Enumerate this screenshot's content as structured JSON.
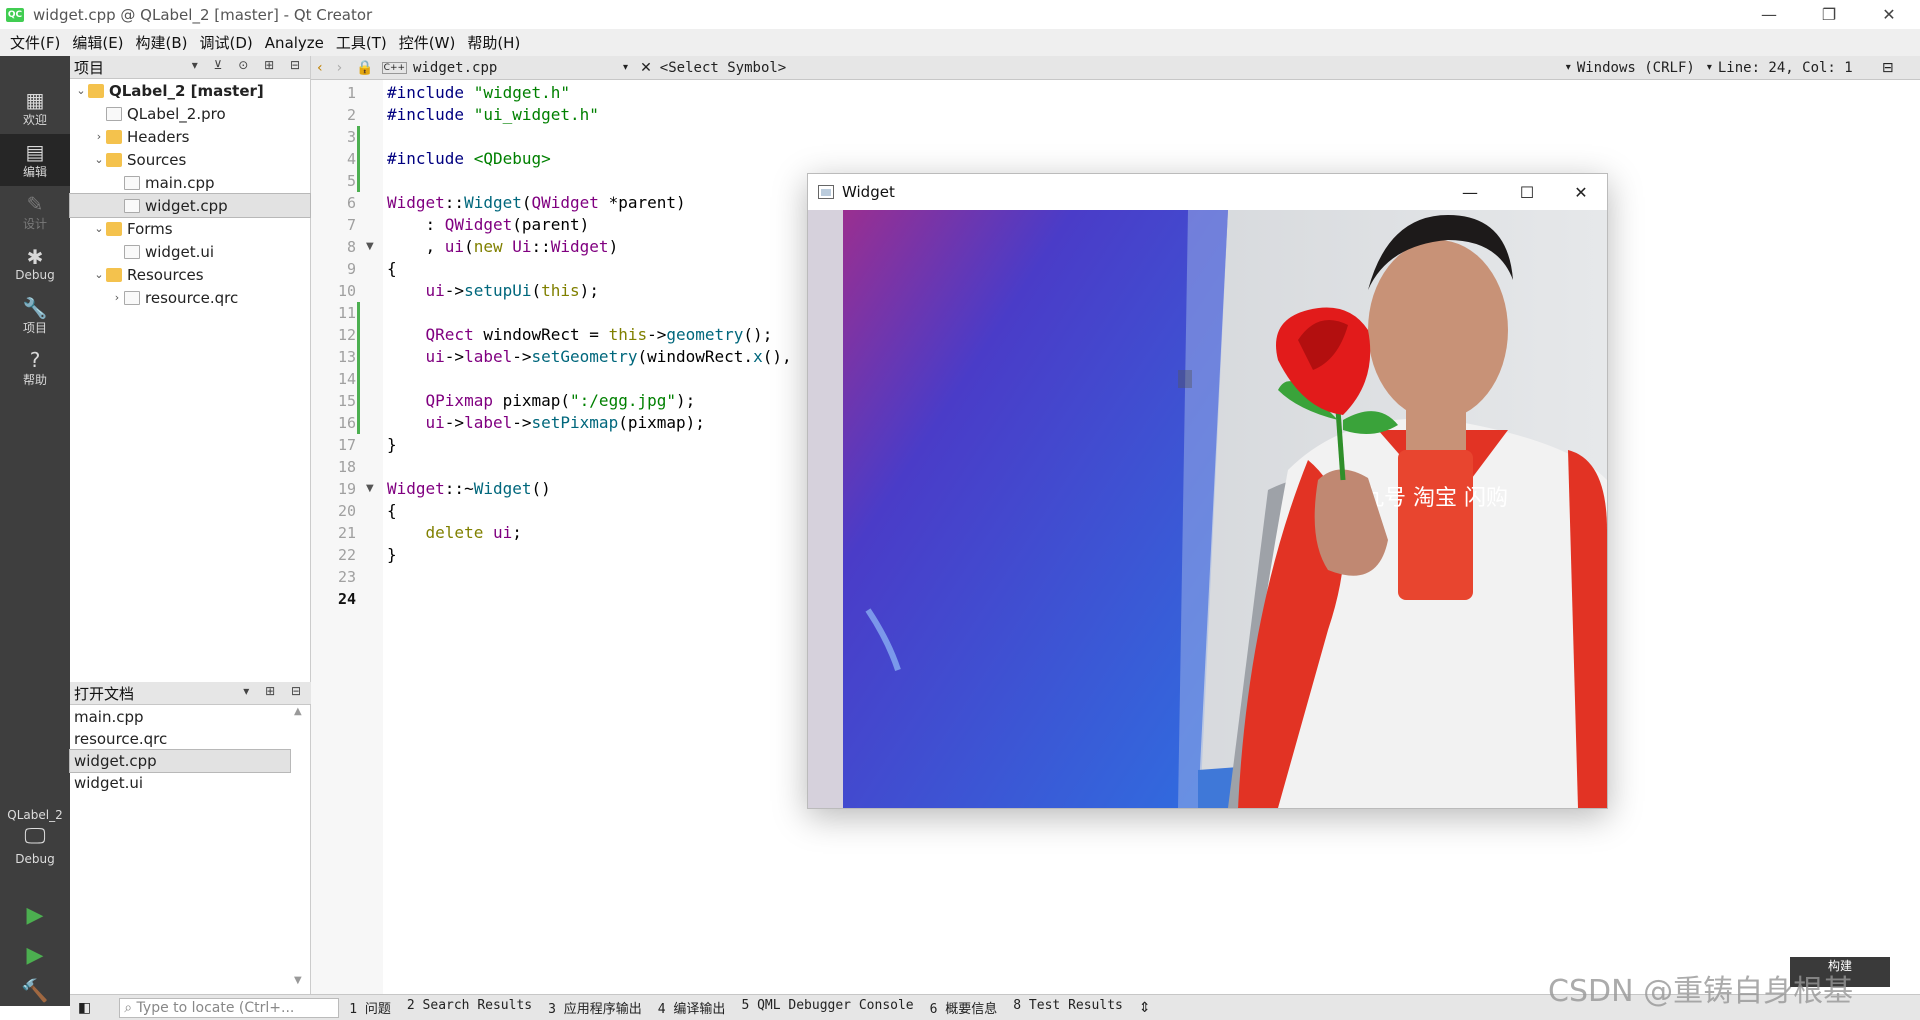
{
  "window": {
    "title": "widget.cpp @ QLabel_2 [master] - Qt Creator",
    "minimize": "—",
    "restore": "❐",
    "close": "✕",
    "icon": "QC"
  },
  "menu": [
    "文件(F)",
    "编辑(E)",
    "构建(B)",
    "调试(D)",
    "Analyze",
    "工具(T)",
    "控件(W)",
    "帮助(H)"
  ],
  "modes": [
    {
      "label": "欢迎",
      "icon": "▦"
    },
    {
      "label": "编辑",
      "icon": "▤"
    },
    {
      "label": "设计",
      "icon": "✎"
    },
    {
      "label": "Debug",
      "icon": "✱"
    },
    {
      "label": "项目",
      "icon": "🔧"
    },
    {
      "label": "帮助",
      "icon": "?"
    }
  ],
  "kit": {
    "project": "QLabel_2",
    "config": "Debug"
  },
  "project_pane": {
    "header": "项目"
  },
  "tree": [
    {
      "label": "QLabel_2 [master]",
      "depth": 0,
      "arrow": "⌄",
      "kind": "folder",
      "bold": true
    },
    {
      "label": "QLabel_2.pro",
      "depth": 1,
      "arrow": "",
      "kind": "file"
    },
    {
      "label": "Headers",
      "depth": 1,
      "arrow": "›",
      "kind": "folder"
    },
    {
      "label": "Sources",
      "depth": 1,
      "arrow": "⌄",
      "kind": "folder"
    },
    {
      "label": "main.cpp",
      "depth": 2,
      "arrow": "",
      "kind": "file"
    },
    {
      "label": "widget.cpp",
      "depth": 2,
      "arrow": "",
      "kind": "file",
      "selected": true
    },
    {
      "label": "Forms",
      "depth": 1,
      "arrow": "⌄",
      "kind": "folder"
    },
    {
      "label": "widget.ui",
      "depth": 2,
      "arrow": "",
      "kind": "file"
    },
    {
      "label": "Resources",
      "depth": 1,
      "arrow": "⌄",
      "kind": "folder"
    },
    {
      "label": "resource.qrc",
      "depth": 2,
      "arrow": "›",
      "kind": "file"
    }
  ],
  "open_docs": {
    "header": "打开文档",
    "items": [
      "main.cpp",
      "resource.qrc",
      "widget.cpp",
      "widget.ui"
    ],
    "selected": 2
  },
  "editor": {
    "filename": "widget.cpp",
    "symbol": "<Select Symbol>",
    "encoding": "Windows (CRLF)",
    "position": "Line: 24, Col: 1",
    "current_line": 24
  },
  "code": [
    [
      [
        "pp",
        "#include "
      ],
      [
        "st",
        "\"widget.h\""
      ]
    ],
    [
      [
        "pp",
        "#include "
      ],
      [
        "st",
        "\"ui_widget.h\""
      ]
    ],
    [],
    [
      [
        "pp",
        "#include "
      ],
      [
        "st",
        "<QDebug>"
      ]
    ],
    [],
    [
      [
        "ty",
        "Widget"
      ],
      [
        "",
        "::"
      ],
      [
        "fn",
        "Widget"
      ],
      [
        "",
        "("
      ],
      [
        "ty",
        "QWidget"
      ],
      [
        "",
        " *"
      ],
      [
        "",
        "parent)"
      ]
    ],
    [
      [
        "",
        "    : "
      ],
      [
        "ty",
        "QWidget"
      ],
      [
        "",
        "(parent)"
      ]
    ],
    [
      [
        "",
        "    , "
      ],
      [
        "ct",
        "ui"
      ],
      [
        "",
        "("
      ],
      [
        "kw",
        "new "
      ],
      [
        "ty",
        "Ui"
      ],
      [
        "",
        "::"
      ],
      [
        "ty",
        "Widget"
      ],
      [
        "",
        ")"
      ]
    ],
    [
      [
        "",
        "{"
      ]
    ],
    [
      [
        "",
        "    "
      ],
      [
        "ct",
        "ui"
      ],
      [
        "",
        "->"
      ],
      [
        "fn",
        "setupUi"
      ],
      [
        "",
        "("
      ],
      [
        "kw",
        "this"
      ],
      [
        "",
        ")"
      ],
      [
        "",
        ";"
      ]
    ],
    [],
    [
      [
        "",
        "    "
      ],
      [
        "ty",
        "QRect"
      ],
      [
        "",
        " windowRect = "
      ],
      [
        "kw",
        "this"
      ],
      [
        "",
        "->"
      ],
      [
        "fn",
        "geometry"
      ],
      [
        "",
        "();"
      ]
    ],
    [
      [
        "",
        "    "
      ],
      [
        "ct",
        "ui"
      ],
      [
        "",
        "->"
      ],
      [
        "ct",
        "label"
      ],
      [
        "",
        "->"
      ],
      [
        "fn",
        "setGeometry"
      ],
      [
        "",
        "(windowRect."
      ],
      [
        "fn",
        "x"
      ],
      [
        "",
        "(),"
      ]
    ],
    [],
    [
      [
        "",
        "    "
      ],
      [
        "ty",
        "QPixmap"
      ],
      [
        "",
        " pixmap("
      ],
      [
        "st",
        "\":/egg.jpg\""
      ],
      [
        "",
        ");"
      ]
    ],
    [
      [
        "",
        "    "
      ],
      [
        "ct",
        "ui"
      ],
      [
        "",
        "->"
      ],
      [
        "ct",
        "label"
      ],
      [
        "",
        "->"
      ],
      [
        "fn",
        "setPixmap"
      ],
      [
        "",
        "(pixmap);"
      ]
    ],
    [
      [
        "",
        "}"
      ]
    ],
    [],
    [
      [
        "ty",
        "Widget"
      ],
      [
        "",
        "::~"
      ],
      [
        "fn",
        "Widget"
      ],
      [
        "",
        "()"
      ]
    ],
    [
      [
        "",
        "{"
      ]
    ],
    [
      [
        "",
        "    "
      ],
      [
        "kw",
        "delete "
      ],
      [
        "ct",
        "ui"
      ],
      [
        "",
        ";"
      ]
    ],
    [
      [
        "",
        "}"
      ]
    ],
    [],
    []
  ],
  "widget_window": {
    "title": "Widget",
    "minimize": "—",
    "maximize": "☐",
    "close": "✕",
    "sign_text": "九号\n淘宝\n闪购"
  },
  "bottom": {
    "locator_placeholder": "Type to locate (Ctrl+...",
    "tabs": [
      "1 问题",
      "2 Search Results",
      "3 应用程序输出",
      "4 编译输出",
      "5 QML Debugger Console",
      "6 概要信息",
      "8 Test Results"
    ]
  },
  "build_button": "构建",
  "watermark": "CSDN @重铸自身根基"
}
